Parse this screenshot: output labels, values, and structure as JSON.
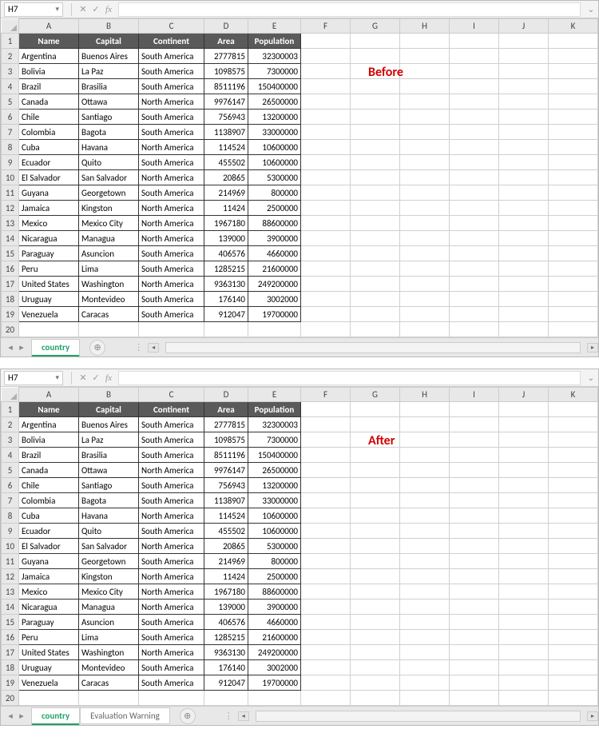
{
  "nameBox": "H7",
  "columns": [
    "A",
    "B",
    "C",
    "D",
    "E",
    "F",
    "G",
    "H",
    "I",
    "J",
    "K"
  ],
  "headers": [
    "Name",
    "Capital",
    "Continent",
    "Area",
    "Population"
  ],
  "rows": [
    {
      "n": "Argentina",
      "cap": "Buenos Aires",
      "cont": "South America",
      "area": "2777815",
      "pop": "32300003"
    },
    {
      "n": "Bolivia",
      "cap": "La Paz",
      "cont": "South America",
      "area": "1098575",
      "pop": "7300000"
    },
    {
      "n": "Brazil",
      "cap": "Brasilia",
      "cont": "South America",
      "area": "8511196",
      "pop": "150400000"
    },
    {
      "n": "Canada",
      "cap": "Ottawa",
      "cont": "North America",
      "area": "9976147",
      "pop": "26500000"
    },
    {
      "n": "Chile",
      "cap": "Santiago",
      "cont": "South America",
      "area": "756943",
      "pop": "13200000"
    },
    {
      "n": "Colombia",
      "cap": "Bagota",
      "cont": "South America",
      "area": "1138907",
      "pop": "33000000"
    },
    {
      "n": "Cuba",
      "cap": "Havana",
      "cont": "North America",
      "area": "114524",
      "pop": "10600000"
    },
    {
      "n": "Ecuador",
      "cap": "Quito",
      "cont": "South America",
      "area": "455502",
      "pop": "10600000"
    },
    {
      "n": "El Salvador",
      "cap": "San Salvador",
      "cont": "North America",
      "area": "20865",
      "pop": "5300000"
    },
    {
      "n": "Guyana",
      "cap": "Georgetown",
      "cont": "South America",
      "area": "214969",
      "pop": "800000"
    },
    {
      "n": "Jamaica",
      "cap": "Kingston",
      "cont": "North America",
      "area": "11424",
      "pop": "2500000"
    },
    {
      "n": "Mexico",
      "cap": "Mexico City",
      "cont": "North America",
      "area": "1967180",
      "pop": "88600000"
    },
    {
      "n": "Nicaragua",
      "cap": "Managua",
      "cont": "North America",
      "area": "139000",
      "pop": "3900000"
    },
    {
      "n": "Paraguay",
      "cap": "Asuncion",
      "cont": "South America",
      "area": "406576",
      "pop": "4660000"
    },
    {
      "n": "Peru",
      "cap": "Lima",
      "cont": "South America",
      "area": "1285215",
      "pop": "21600000"
    },
    {
      "n": "United States",
      "cap": "Washington",
      "cont": "North America",
      "area": "9363130",
      "pop": "249200000"
    },
    {
      "n": "Uruguay",
      "cap": "Montevideo",
      "cont": "South America",
      "area": "176140",
      "pop": "3002000"
    },
    {
      "n": "Venezuela",
      "cap": "Caracas",
      "cont": "South America",
      "area": "912047",
      "pop": "19700000"
    }
  ],
  "panes": [
    {
      "label": "Before",
      "extraTab": null
    },
    {
      "label": "After",
      "extraTab": "Evaluation Warning"
    }
  ],
  "sheetTab": "country"
}
